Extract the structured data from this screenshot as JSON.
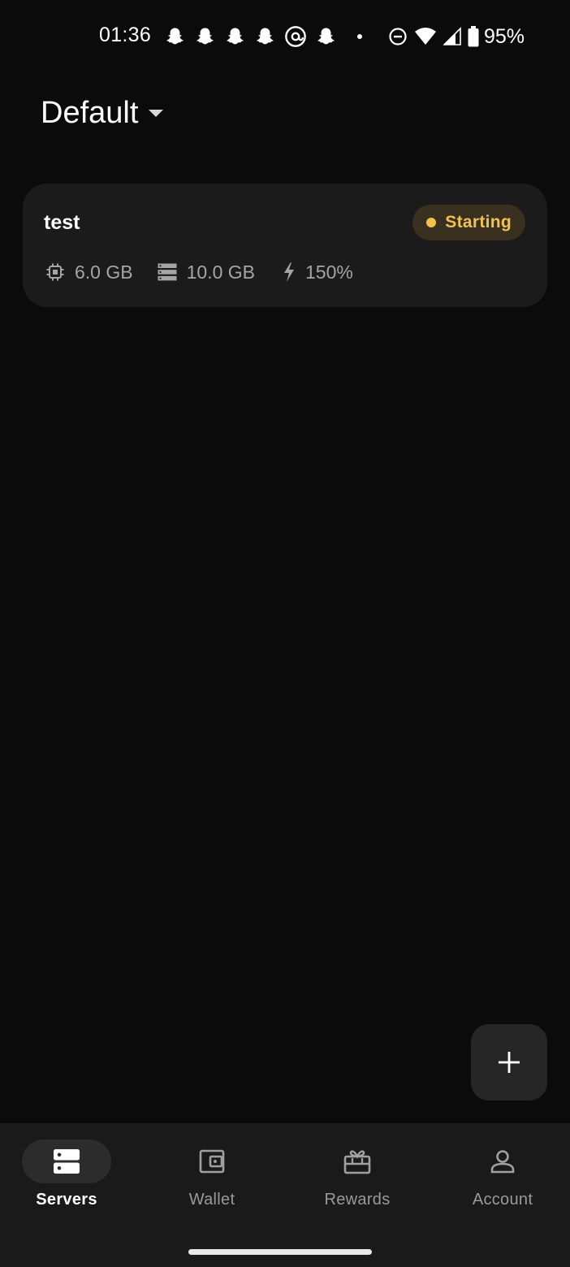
{
  "status_bar": {
    "time": "01:36",
    "notification_icons": [
      "snapchat-icon",
      "snapchat-icon",
      "snapchat-icon",
      "snapchat-icon",
      "threads-icon",
      "snapchat-icon",
      "more-dot-icon"
    ],
    "system_icons": [
      "do-not-disturb-icon",
      "wifi-icon",
      "signal-icon",
      "battery-icon"
    ],
    "battery_percent": "95%"
  },
  "header": {
    "title": "Default",
    "dropdown_icon": "caret-down-icon"
  },
  "servers": [
    {
      "name": "test",
      "status": "Starting",
      "status_color": "#f2c14e",
      "specs": {
        "memory": {
          "icon": "chip-icon",
          "value": "6.0 GB"
        },
        "storage": {
          "icon": "storage-icon",
          "value": "10.0 GB"
        },
        "cpu": {
          "icon": "bolt-icon",
          "value": "150%"
        }
      }
    }
  ],
  "fab": {
    "icon": "plus-icon"
  },
  "bottom_nav": {
    "items": [
      {
        "label": "Servers",
        "icon": "servers-icon",
        "active": true
      },
      {
        "label": "Wallet",
        "icon": "wallet-icon",
        "active": false
      },
      {
        "label": "Rewards",
        "icon": "gift-icon",
        "active": false
      },
      {
        "label": "Account",
        "icon": "account-icon",
        "active": false
      }
    ]
  },
  "colors": {
    "background": "#0b0b0b",
    "card": "#1b1b1b",
    "accent_status": "#f2c14e",
    "nav_background": "#1a1a1a"
  }
}
